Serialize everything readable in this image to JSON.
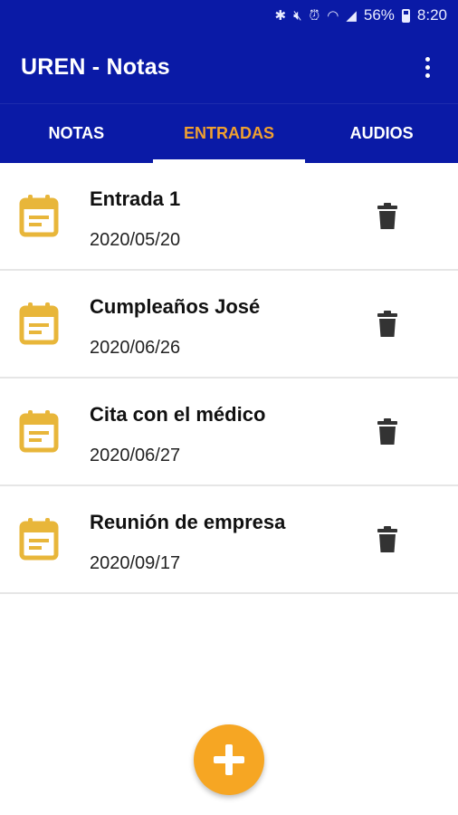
{
  "status_bar": {
    "battery_percent": "56%",
    "time": "8:20",
    "icons": [
      "bluetooth-icon",
      "mute-icon",
      "alarm-icon",
      "wifi-icon",
      "signal-icon",
      "battery-icon"
    ]
  },
  "app_bar": {
    "title": "UREN - Notas",
    "menu_icon": "more-vert-icon"
  },
  "tabs": [
    {
      "label": "NOTAS",
      "active": false
    },
    {
      "label": "ENTRADAS",
      "active": true
    },
    {
      "label": "AUDIOS",
      "active": false
    }
  ],
  "entries": [
    {
      "title": "Entrada 1",
      "date": "2020/05/20",
      "icon": "event-note-icon"
    },
    {
      "title": "Cumpleaños José",
      "date": "2020/06/26",
      "icon": "event-note-icon"
    },
    {
      "title": "Cita con el médico",
      "date": "2020/06/27",
      "icon": "event-note-icon"
    },
    {
      "title": "Reunión de empresa",
      "date": "2020/09/17",
      "icon": "event-note-icon"
    }
  ],
  "fab": {
    "icon": "add-icon"
  },
  "colors": {
    "primary": "#0a1aa6",
    "accent": "#f0a030",
    "fab": "#f6a623",
    "entry_icon": "#e8b63a"
  }
}
